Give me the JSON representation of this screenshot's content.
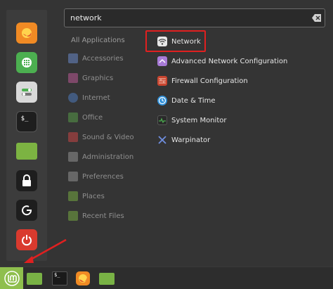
{
  "search": {
    "value": "network"
  },
  "categories": [
    "All Applications",
    "Accessories",
    "Graphics",
    "Internet",
    "Office",
    "Sound & Video",
    "Administration",
    "Preferences",
    "Places",
    "Recent Files"
  ],
  "results": [
    "Network",
    "Advanced Network Configuration",
    "Firewall Configuration",
    "Date & Time",
    "System Monitor",
    "Warpinator"
  ],
  "favorites_icons": [
    "firefox-icon",
    "software-manager-icon",
    "settings-icon",
    "terminal-icon",
    "files-icon",
    "lock-screen-icon",
    "logout-icon",
    "power-icon"
  ],
  "panel_icons": [
    "menu-icon",
    "files-icon",
    "terminal-icon",
    "firefox-icon",
    "folder-icon"
  ],
  "colors": {
    "highlight": "#e02020",
    "menu_button": "#8fbf4d",
    "firefox": "#f08a24",
    "folder": "#79b245",
    "power": "#d93a2e"
  }
}
